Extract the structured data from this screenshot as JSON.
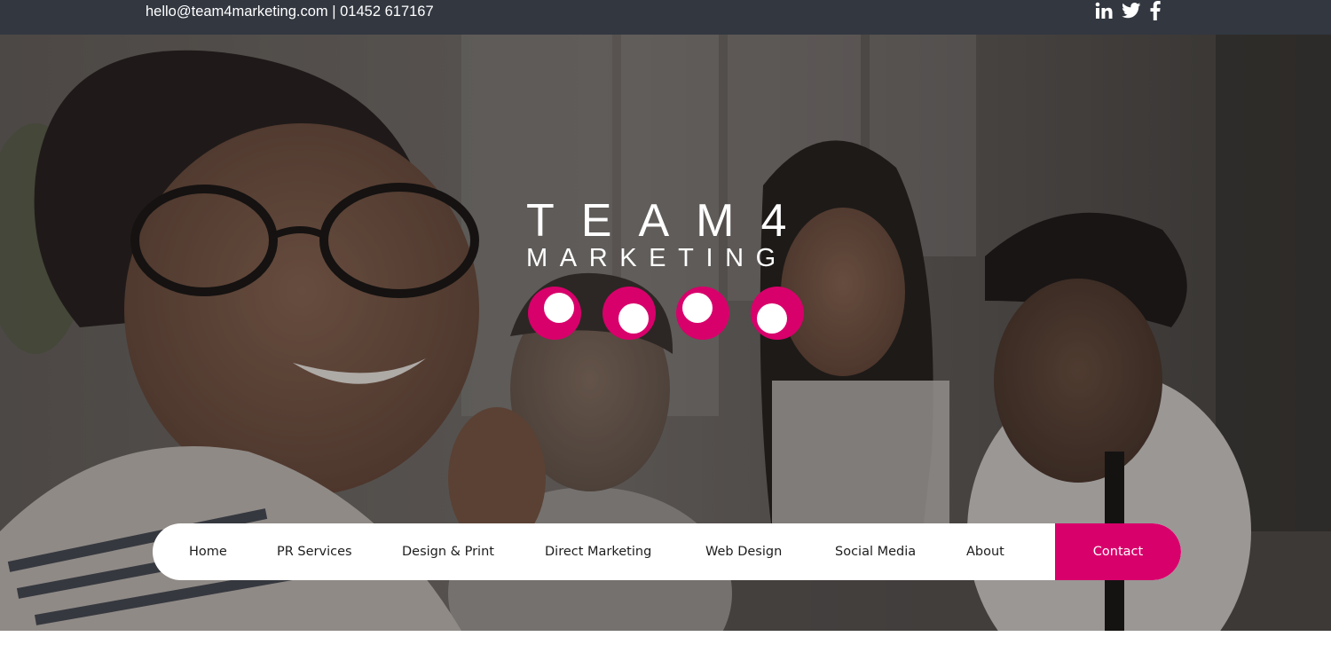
{
  "topbar": {
    "contact_text": "hello@team4marketing.com | 01452 617167",
    "social_icons": [
      "linkedin-icon",
      "twitter-icon",
      "facebook-icon"
    ]
  },
  "brand": {
    "line1": "TEAM4",
    "line2": "MARKETING",
    "accent_color": "#d8006b",
    "topbar_color": "#323740"
  },
  "nav": {
    "items": [
      {
        "label": "Home"
      },
      {
        "label": "PR Services"
      },
      {
        "label": "Design & Print"
      },
      {
        "label": "Direct Marketing"
      },
      {
        "label": "Web Design"
      },
      {
        "label": "Social Media"
      },
      {
        "label": "About"
      }
    ],
    "contact_label": "Contact"
  }
}
